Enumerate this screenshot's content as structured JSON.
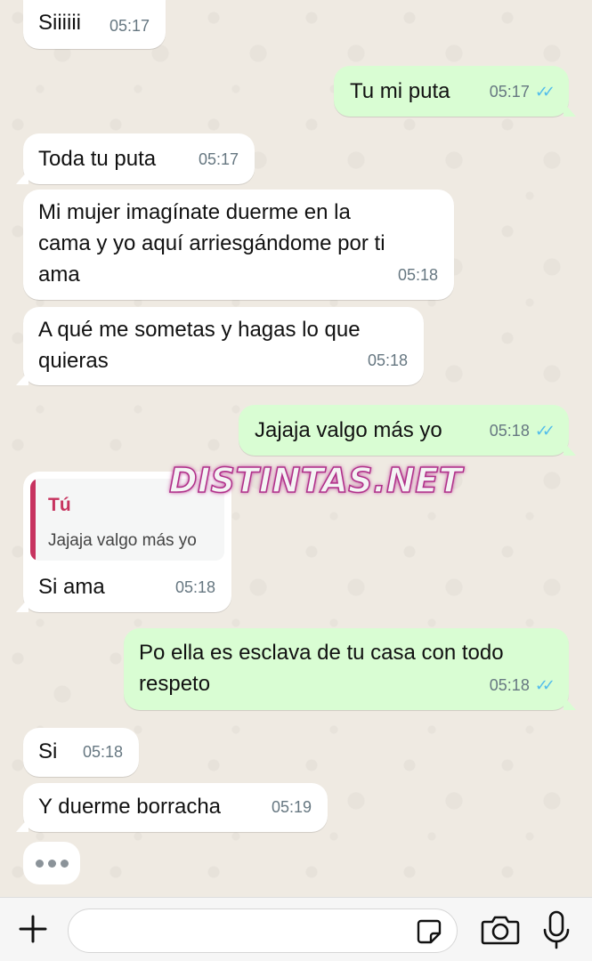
{
  "watermark": "DISTINTAS.NET",
  "messages": [
    {
      "text": "Siiiiii",
      "time": "05:17"
    },
    {
      "text": "Tu mi puta",
      "time": "05:17"
    },
    {
      "text": "Toda tu puta",
      "time": "05:17"
    },
    {
      "text": "Mi mujer imagínate duerme en la\ncama y yo aquí arriesgándome por ti\nama",
      "time": "05:18"
    },
    {
      "text": "A qué me sometas y hagas lo que\nquieras",
      "time": "05:18"
    },
    {
      "text": "Jajaja valgo más yo",
      "time": "05:18"
    },
    {
      "quote_author": "Tú",
      "quote_text": "Jajaja valgo más yo",
      "text": "Si ama",
      "time": "05:18"
    },
    {
      "text": "Po ella es esclava de tu casa con todo\nrespeto",
      "time": "05:18"
    },
    {
      "text": "Si",
      "time": "05:18"
    },
    {
      "text": "Y duerme borracha",
      "time": "05:19"
    }
  ],
  "colors": {
    "background": "#efeae2",
    "incoming": "#ffffff",
    "outgoing": "#d9fdd3",
    "read_ticks": "#53bdeb",
    "quote_accent": "#c7335f"
  },
  "icons": {
    "add": "plus-icon",
    "sticker": "sticker-icon",
    "camera": "camera-icon",
    "mic": "microphone-icon",
    "read": "double-check-icon"
  }
}
